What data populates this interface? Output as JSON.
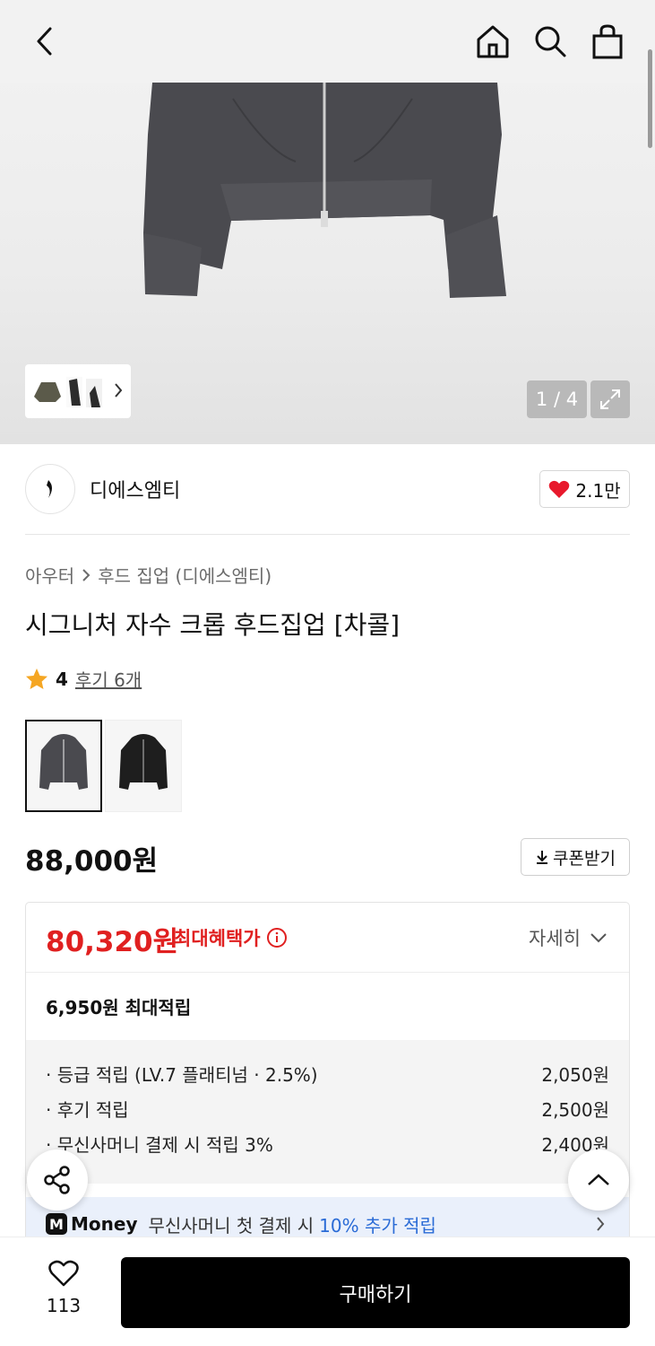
{
  "gallery": {
    "counter": "1 / 4"
  },
  "brand": {
    "name": "디에스엠티",
    "likes": "2.1만"
  },
  "breadcrumb": {
    "category": "아우터",
    "subcategory": "후드 집업 (디에스엠티)"
  },
  "product": {
    "title": "시그니처 자수 크롭 후드집업 [차콜]",
    "rating": "4",
    "reviews": "후기 6개",
    "price": "88,000원",
    "coupon_label": "쿠폰받기"
  },
  "benefits": {
    "sale_price": "80,320원",
    "sale_label": "최대혜택가",
    "detail_label": "자세히",
    "max_points": "6,950원 최대적립",
    "points": [
      {
        "label": "· 등급 적립 (LV.7 플래티넘 · 2.5%)",
        "value": "2,050원"
      },
      {
        "label": "· 후기 적립",
        "value": "2,500원"
      },
      {
        "label": "· 무신사머니 결제 시 적립 3%",
        "value": "2,400원"
      }
    ],
    "money_logo": "Money",
    "money_text": "무신사머니 첫 결제 시",
    "money_highlight": "10% 추가 적립"
  },
  "bottom": {
    "wish_count": "113",
    "buy_label": "구매하기"
  },
  "colors": {
    "sale_red": "#e02020",
    "heart_red": "#e8192c",
    "money_blue": "#2a6bd6",
    "star_orange": "#f5a623"
  }
}
